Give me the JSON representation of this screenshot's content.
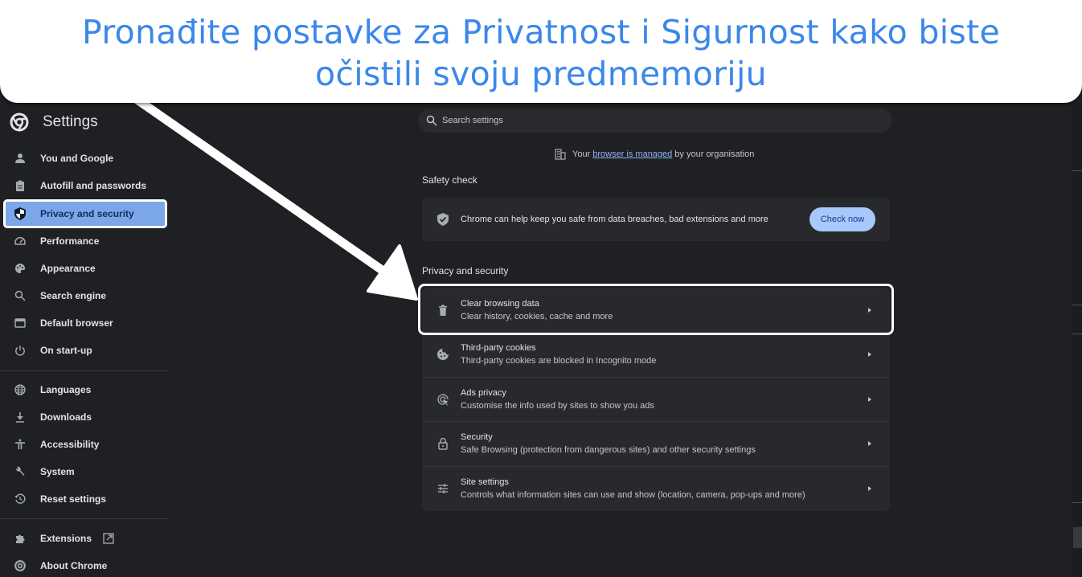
{
  "banner": {
    "line1": "Pronađite postavke za Privatnost i Sigurnost kako biste",
    "line2": "očistili svoju predmemoriju"
  },
  "sidebar": {
    "title": "Settings",
    "logo_icon": "chrome-logo-icon",
    "items": [
      {
        "label": "You and Google",
        "icon": "person-icon"
      },
      {
        "label": "Autofill and passwords",
        "icon": "clipboard-icon"
      },
      {
        "label": "Privacy and security",
        "icon": "shield-icon",
        "active": true
      },
      {
        "label": "Performance",
        "icon": "speedometer-icon"
      },
      {
        "label": "Appearance",
        "icon": "palette-icon"
      },
      {
        "label": "Search engine",
        "icon": "search-icon"
      },
      {
        "label": "Default browser",
        "icon": "browser-window-icon"
      },
      {
        "label": "On start-up",
        "icon": "power-icon"
      },
      {
        "label": "Languages",
        "icon": "globe-icon"
      },
      {
        "label": "Downloads",
        "icon": "download-icon"
      },
      {
        "label": "Accessibility",
        "icon": "accessibility-icon"
      },
      {
        "label": "System",
        "icon": "wrench-icon"
      },
      {
        "label": "Reset settings",
        "icon": "history-icon"
      },
      {
        "label": "Extensions",
        "icon": "puzzle-icon",
        "external": true
      },
      {
        "label": "About Chrome",
        "icon": "chrome-logo-icon"
      }
    ]
  },
  "search": {
    "placeholder": "Search settings",
    "value": ""
  },
  "managed": {
    "prefix": "Your",
    "link": "browser is managed",
    "suffix": "by your organisation"
  },
  "safety_check": {
    "title": "Safety check",
    "text": "Chrome can help keep you safe from data breaches, bad extensions and more",
    "button": "Check now"
  },
  "privacy": {
    "title": "Privacy and security",
    "rows": [
      {
        "title": "Clear browsing data",
        "subtitle": "Clear history, cookies, cache and more",
        "icon": "trash-icon",
        "highlighted": true
      },
      {
        "title": "Third-party cookies",
        "subtitle": "Third-party cookies are blocked in Incognito mode",
        "icon": "cookie-icon"
      },
      {
        "title": "Ads privacy",
        "subtitle": "Customise the info used by sites to show you ads",
        "icon": "ads-target-icon"
      },
      {
        "title": "Security",
        "subtitle": "Safe Browsing (protection from dangerous sites) and other security settings",
        "icon": "lock-icon"
      },
      {
        "title": "Site settings",
        "subtitle": "Controls what information sites can use and show (location, camera, pop-ups and more)",
        "icon": "sliders-icon"
      }
    ]
  },
  "colors": {
    "banner_text": "#3b87ea",
    "active_item_bg": "#7ba6ea",
    "button_bg": "#a8c7fa",
    "link": "#8ab4f8",
    "page_bg": "#1f2023",
    "card_bg": "#28292c"
  }
}
